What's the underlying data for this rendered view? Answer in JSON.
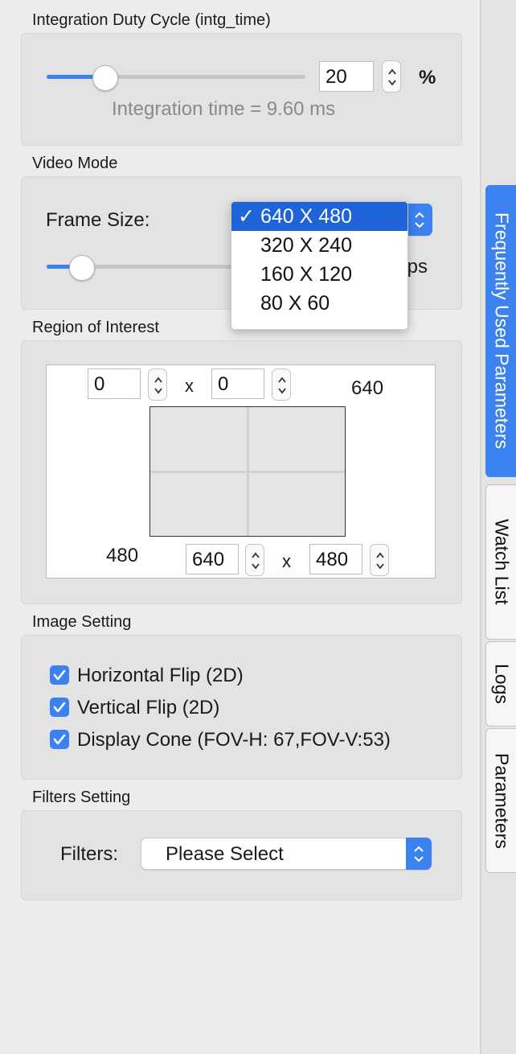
{
  "integration": {
    "section_title": "Integration Duty Cycle (intg_time)",
    "slider_value_percent": 20,
    "value": "20",
    "unit": "%",
    "info": "Integration time = 9.60 ms"
  },
  "video_mode": {
    "section_title": "Video Mode",
    "frame_size_label": "Frame Size:",
    "frame_size_options": [
      "640 X 480",
      "320 X 240",
      "160 X 120",
      "80 X 60"
    ],
    "selected_index": 0,
    "check_mark": "✓",
    "fps_unit_partial": "fps"
  },
  "roi": {
    "section_title": "Region of Interest",
    "x_value": "0",
    "y_value": "0",
    "x_separator": "x",
    "max_width_label": "640",
    "max_height_label": "480",
    "width_value": "640",
    "height_value": "480"
  },
  "image_setting": {
    "section_title": "Image Setting",
    "checkboxes": [
      {
        "label": "Horizontal Flip (2D)",
        "checked": true
      },
      {
        "label": "Vertical Flip (2D)",
        "checked": true
      },
      {
        "label": "Display Cone (FOV-H: 67,FOV-V:53)",
        "checked": true
      }
    ]
  },
  "filters": {
    "section_title": "Filters Setting",
    "label": "Filters:",
    "selected": "Please Select"
  },
  "side_tabs": [
    {
      "label": "Frequently Used Parameters",
      "active": true
    },
    {
      "label": "Watch List",
      "active": false
    },
    {
      "label": "Logs",
      "active": false
    },
    {
      "label": "Parameters",
      "active": false
    }
  ],
  "colors": {
    "accent": "#3b82f0",
    "selection": "#1e63d8"
  }
}
